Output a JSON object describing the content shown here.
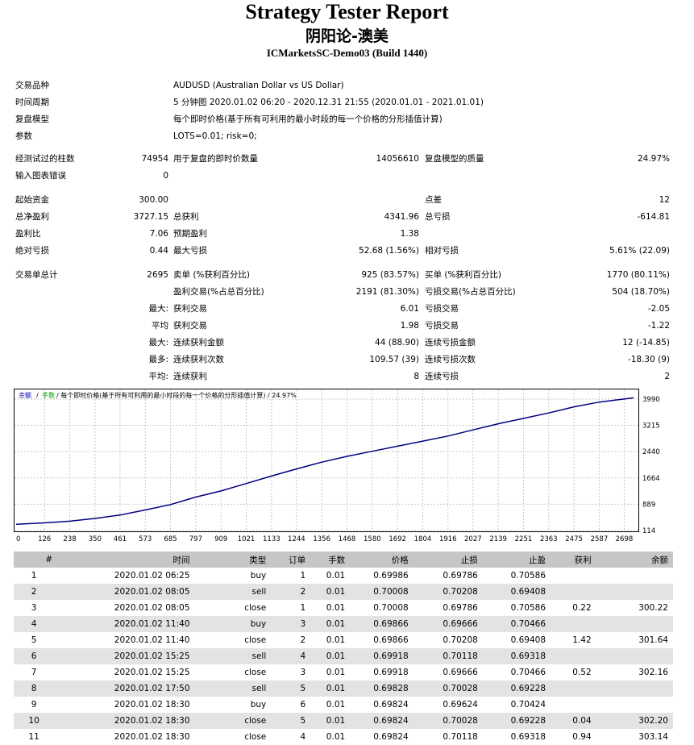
{
  "report": {
    "title": "Strategy Tester Report",
    "ea_name": "阴阳论-澳美",
    "server": "ICMarketsSC-Demo03 (Build 1440)"
  },
  "settings": {
    "symbol_label": "交易品种",
    "symbol": "AUDUSD (Australian Dollar vs US Dollar)",
    "period_label": "时间周期",
    "period": "5 分钟图 2020.01.02 06:20 - 2020.12.31 21:55 (2020.01.01 - 2021.01.01)",
    "model_label": "复盘模型",
    "model": "每个即时价格(基于所有可利用的最小时段的每一个价格的分形插值计算)",
    "params_label": "参数",
    "params": "LOTS=0.01; risk=0;"
  },
  "stats": {
    "bars_label": "经测试过的柱数",
    "bars": "74954",
    "ticks_label": "用于复盘的即时价数量",
    "ticks": "14056610",
    "quality_label": "复盘模型的质量",
    "quality": "24.97%",
    "errors_label": "输入图表错误",
    "errors": "0",
    "deposit_label": "起始资金",
    "deposit": "300.00",
    "spread_label": "点差",
    "spread": "12",
    "net_label": "总净盈利",
    "net": "3727.15",
    "gross_profit_label": "总获利",
    "gross_profit": "4341.96",
    "gross_loss_label": "总亏损",
    "gross_loss": "-614.81",
    "pf_label": "盈利比",
    "pf": "7.06",
    "expected_label": "预期盈利",
    "expected": "1.38",
    "abs_dd_label": "绝对亏损",
    "abs_dd": "0.44",
    "max_dd_label": "最大亏损",
    "max_dd": "52.68 (1.56%)",
    "rel_dd_label": "相对亏损",
    "rel_dd": "5.61% (22.09)",
    "total_label": "交易单总计",
    "total": "2695",
    "short_label": "卖单 (%获利百分比)",
    "short": "925 (83.57%)",
    "long_label": "买单 (%获利百分比)",
    "long": "1770 (80.11%)",
    "win_label": "盈利交易(%占总百分比)",
    "win": "2191 (81.30%)",
    "loss_label": "亏损交易(%占总百分比)",
    "loss": "504 (18.70%)",
    "r1_prefix": "最大:",
    "r1_a_label": "获利交易",
    "r1_a": "6.01",
    "r1_b_label": "亏损交易",
    "r1_b": "-2.05",
    "r2_prefix": "平均",
    "r2_a_label": "获利交易",
    "r2_a": "1.98",
    "r2_b_label": "亏损交易",
    "r2_b": "-1.22",
    "r3_prefix": "最大:",
    "r3_a_label": "连续获利金额",
    "r3_a": "44 (88.90)",
    "r3_b_label": "连续亏损金额",
    "r3_b": "12 (-14.85)",
    "r4_prefix": "最多:",
    "r4_a_label": "连续获利次数",
    "r4_a": "109.57 (39)",
    "r4_b_label": "连续亏损次数",
    "r4_b": "-18.30 (9)",
    "r5_prefix": "平均:",
    "r5_a_label": "连续获利",
    "r5_a": "8",
    "r5_b_label": "连续亏损",
    "r5_b": "2"
  },
  "chart_data": {
    "type": "line",
    "legend_balance": "余额",
    "legend_sep": "/",
    "legend_lot": "手数",
    "legend_text": "/ 每个即时价格(基于所有可利用的最小时段的每一个价格的分形插值计算) / 24.97%",
    "legend_colors": {
      "balance": "#0000b4",
      "lot": "#00a000"
    },
    "line_color": "#000080",
    "grid": true,
    "xlim": [
      0,
      2750
    ],
    "ylim": [
      114,
      4250
    ],
    "x_ticks": [
      "0",
      "126",
      "238",
      "350",
      "461",
      "573",
      "685",
      "797",
      "909",
      "1021",
      "1133",
      "1244",
      "1356",
      "1468",
      "1580",
      "1692",
      "1804",
      "1916",
      "2027",
      "2139",
      "2251",
      "2363",
      "2475",
      "2587",
      "2698"
    ],
    "y_ticks": [
      "3990",
      "3215",
      "2440",
      "1664",
      "889",
      "114"
    ],
    "series": [
      {
        "x": [
          0,
          126,
          238,
          350,
          461,
          573,
          685,
          797,
          909,
          1021,
          1133,
          1244,
          1356,
          1468,
          1580,
          1692,
          1804,
          1916,
          2027,
          2139,
          2251,
          2363,
          2475,
          2587,
          2698,
          2740
        ],
        "values": [
          300,
          340,
          390,
          470,
          570,
          720,
          880,
          1100,
          1280,
          1500,
          1720,
          1930,
          2130,
          2300,
          2450,
          2600,
          2750,
          2900,
          3080,
          3260,
          3420,
          3580,
          3760,
          3900,
          3990,
          4027
        ]
      }
    ]
  },
  "trades": {
    "headers": [
      "#",
      "时间",
      "类型",
      "订单",
      "手数",
      "价格",
      "止损",
      "止盈",
      "获利",
      "余额"
    ],
    "rows": [
      [
        "1",
        "2020.01.02 06:25",
        "buy",
        "1",
        "0.01",
        "0.69986",
        "0.69786",
        "0.70586",
        "",
        ""
      ],
      [
        "2",
        "2020.01.02 08:05",
        "sell",
        "2",
        "0.01",
        "0.70008",
        "0.70208",
        "0.69408",
        "",
        ""
      ],
      [
        "3",
        "2020.01.02 08:05",
        "close",
        "1",
        "0.01",
        "0.70008",
        "0.69786",
        "0.70586",
        "0.22",
        "300.22"
      ],
      [
        "4",
        "2020.01.02 11:40",
        "buy",
        "3",
        "0.01",
        "0.69866",
        "0.69666",
        "0.70466",
        "",
        ""
      ],
      [
        "5",
        "2020.01.02 11:40",
        "close",
        "2",
        "0.01",
        "0.69866",
        "0.70208",
        "0.69408",
        "1.42",
        "301.64"
      ],
      [
        "6",
        "2020.01.02 15:25",
        "sell",
        "4",
        "0.01",
        "0.69918",
        "0.70118",
        "0.69318",
        "",
        ""
      ],
      [
        "7",
        "2020.01.02 15:25",
        "close",
        "3",
        "0.01",
        "0.69918",
        "0.69666",
        "0.70466",
        "0.52",
        "302.16"
      ],
      [
        "8",
        "2020.01.02 17:50",
        "sell",
        "5",
        "0.01",
        "0.69828",
        "0.70028",
        "0.69228",
        "",
        ""
      ],
      [
        "9",
        "2020.01.02 18:30",
        "buy",
        "6",
        "0.01",
        "0.69824",
        "0.69624",
        "0.70424",
        "",
        ""
      ],
      [
        "10",
        "2020.01.02 18:30",
        "close",
        "5",
        "0.01",
        "0.69824",
        "0.70028",
        "0.69228",
        "0.04",
        "302.20"
      ],
      [
        "11",
        "2020.01.02 18:30",
        "close",
        "4",
        "0.01",
        "0.69824",
        "0.70118",
        "0.69318",
        "0.94",
        "303.14"
      ]
    ]
  }
}
